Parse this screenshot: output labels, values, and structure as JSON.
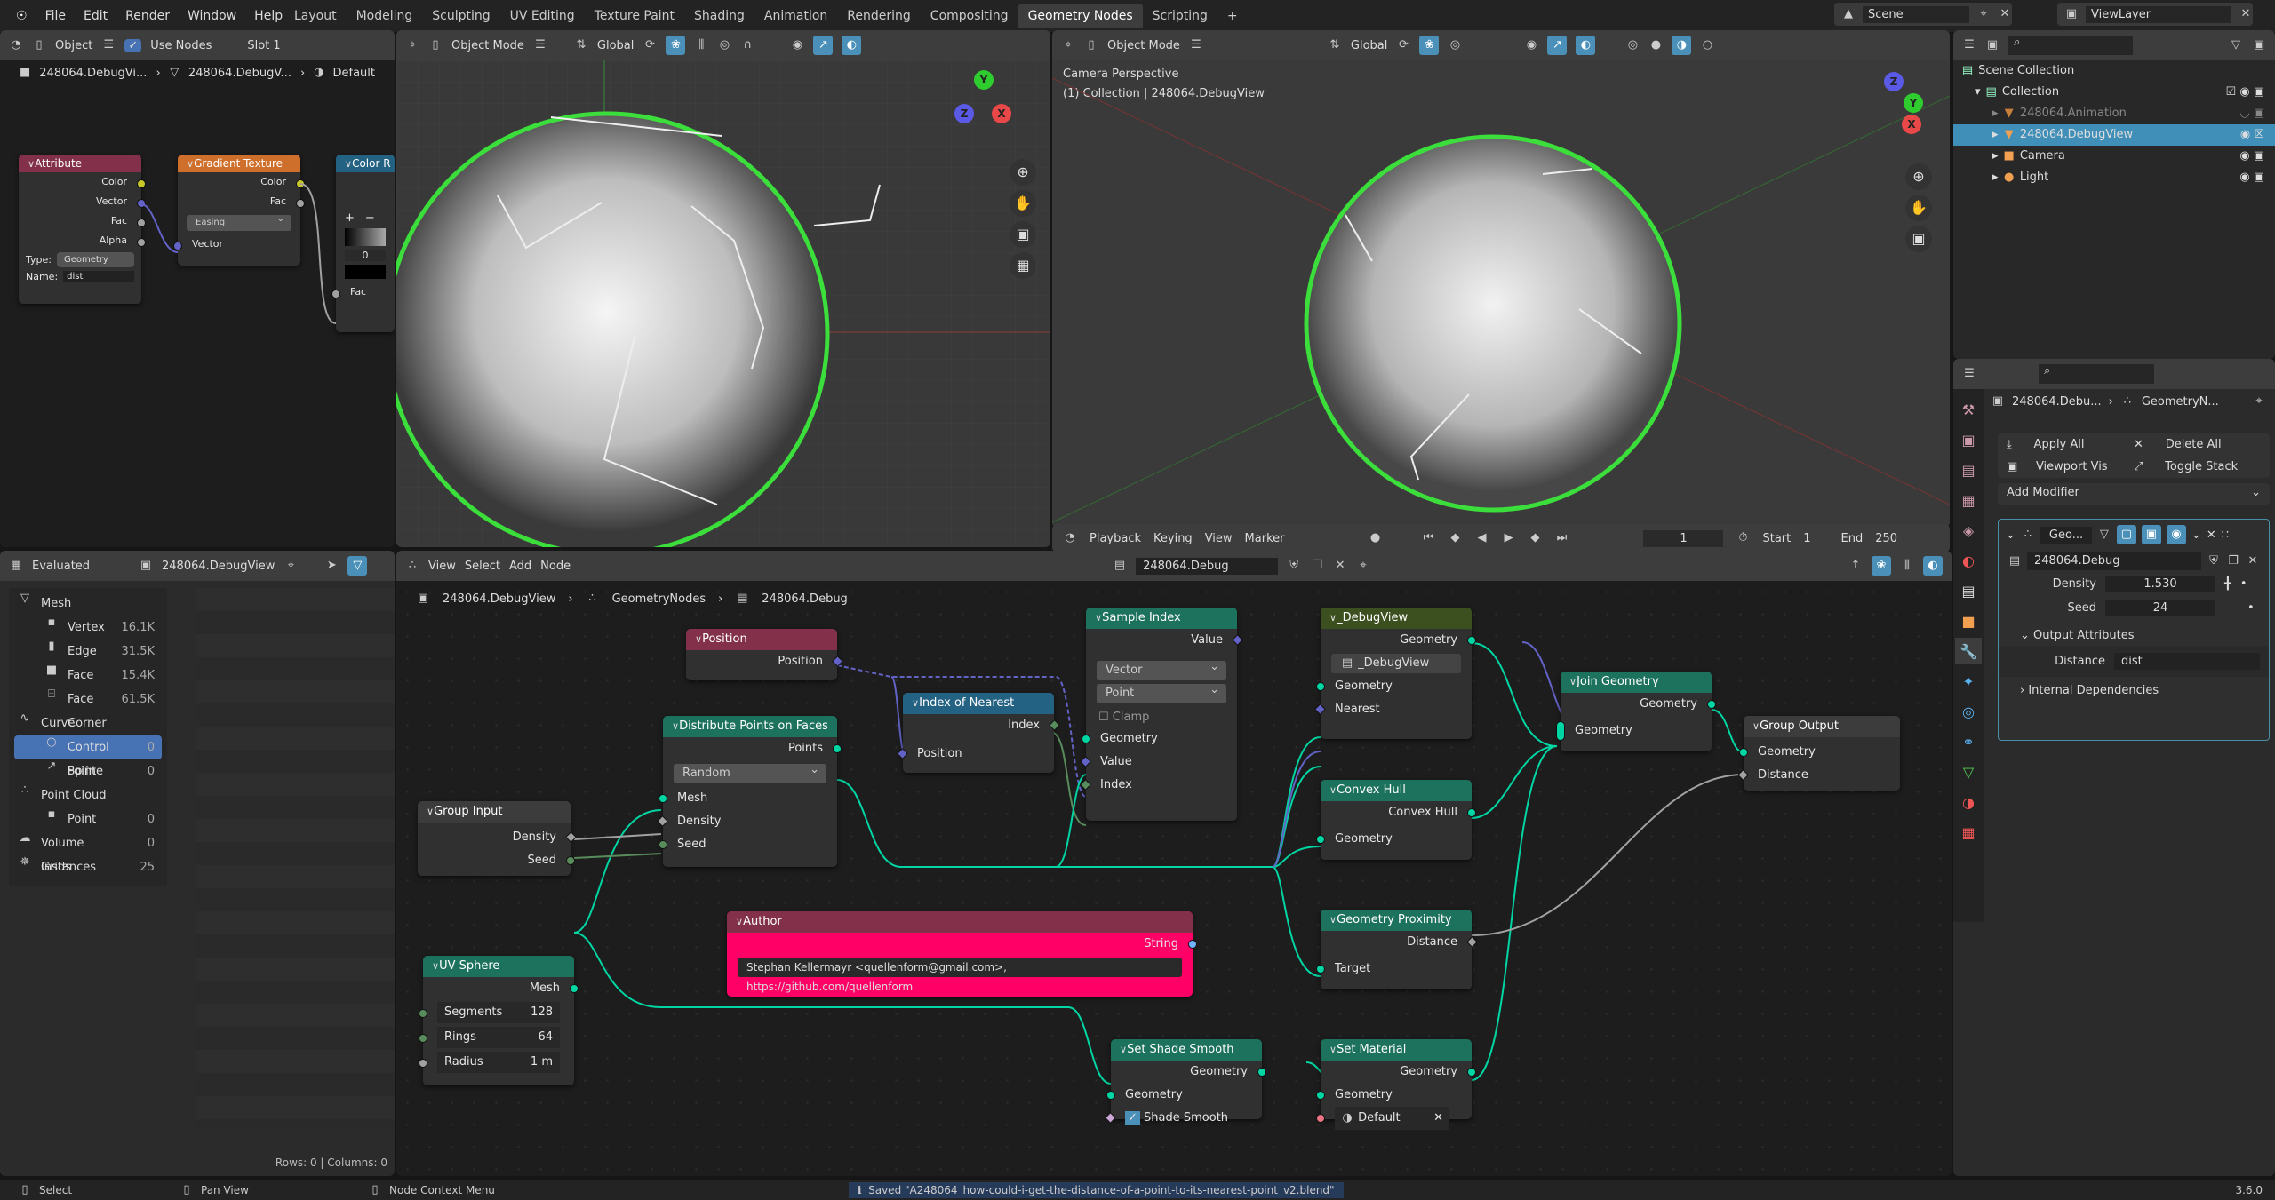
{
  "topbar": {
    "menus": [
      "File",
      "Edit",
      "Render",
      "Window",
      "Help"
    ],
    "workspaces": [
      "Layout",
      "Modeling",
      "Sculpting",
      "UV Editing",
      "Texture Paint",
      "Shading",
      "Animation",
      "Rendering",
      "Compositing",
      "Geometry Nodes",
      "Scripting"
    ],
    "active_workspace": "Geometry Nodes",
    "add_workspace": "+",
    "scene": "Scene",
    "view_layer": "ViewLayer"
  },
  "shader_editor": {
    "object_type": "Object",
    "use_nodes_label": "Use Nodes",
    "use_nodes_checked": true,
    "slot": "Slot 1",
    "breadcrumb": [
      "248064.DebugVi...",
      "248064.DebugV...",
      "Default"
    ],
    "nodes": {
      "attribute": {
        "title": "Attribute",
        "outputs": [
          "Color",
          "Vector",
          "Fac",
          "Alpha"
        ],
        "type_label": "Type:",
        "type_value": "Geometry",
        "name_label": "Name:",
        "name_value": "dist"
      },
      "gradient": {
        "title": "Gradient Texture",
        "outputs": [
          "Color",
          "Fac"
        ],
        "mode": "Easing",
        "input": "Vector"
      },
      "color_ramp": {
        "title": "Color R",
        "plus": "+",
        "minus": "−",
        "pos_value": "0",
        "input": "Fac"
      }
    }
  },
  "viewport_left": {
    "mode": "Object Mode",
    "orientation": "Global",
    "gizmo": {
      "y": "Y",
      "x": "X",
      "z": "Z"
    }
  },
  "viewport_right": {
    "mode": "Object Mode",
    "orientation": "Global",
    "camera_label": "Camera Perspective",
    "collection_label": "(1) Collection | 248064.DebugView",
    "gizmo": {
      "z": "Z",
      "y": "Y",
      "x": "X"
    }
  },
  "outliner": {
    "search_placeholder": "",
    "items": [
      {
        "label": "Scene Collection",
        "level": 0
      },
      {
        "label": "Collection",
        "level": 1
      },
      {
        "label": "248064.Animation",
        "level": 2,
        "dim": true
      },
      {
        "label": "248064.DebugView",
        "level": 2,
        "selected": true
      },
      {
        "label": "Camera",
        "level": 2
      },
      {
        "label": "Light",
        "level": 2
      }
    ]
  },
  "timeline": {
    "menus": [
      "Playback",
      "Keying",
      "View",
      "Marker"
    ],
    "current_frame": "1",
    "start_label": "Start",
    "start": "1",
    "end_label": "End",
    "end": "250"
  },
  "spreadsheet": {
    "mode": "Evaluated",
    "object": "248064.DebugView",
    "rows": [
      {
        "label": "Mesh",
        "count": "",
        "level": 0,
        "icon": "mesh-icon"
      },
      {
        "label": "Vertex",
        "count": "16.1K",
        "level": 1,
        "icon": "vertex-icon"
      },
      {
        "label": "Edge",
        "count": "31.5K",
        "level": 1,
        "icon": "edge-icon"
      },
      {
        "label": "Face",
        "count": "15.4K",
        "level": 1,
        "icon": "face-icon"
      },
      {
        "label": "Face Corner",
        "count": "61.5K",
        "level": 1,
        "icon": "face-corner-icon"
      },
      {
        "label": "Curve",
        "count": "",
        "level": 0,
        "icon": "curve-icon"
      },
      {
        "label": "Control Point",
        "count": "0",
        "level": 1,
        "icon": "control-point-icon",
        "selected": true
      },
      {
        "label": "Spline",
        "count": "0",
        "level": 1,
        "icon": "spline-icon"
      },
      {
        "label": "Point Cloud",
        "count": "",
        "level": 0,
        "icon": "point-cloud-icon"
      },
      {
        "label": "Point",
        "count": "0",
        "level": 1,
        "icon": "point-icon"
      },
      {
        "label": "Volume Grids",
        "count": "0",
        "level": 0,
        "icon": "volume-icon"
      },
      {
        "label": "Instances",
        "count": "25",
        "level": 0,
        "icon": "instances-icon"
      }
    ],
    "footer": "Rows: 0  |  Columns: 0"
  },
  "node_editor": {
    "menus": [
      "View",
      "Select",
      "Add",
      "Node"
    ],
    "node_tree": "248064.Debug",
    "breadcrumb": [
      "248064.DebugView",
      "GeometryNodes",
      "248064.Debug"
    ],
    "nodes": {
      "position": {
        "title": "Position",
        "out": "Position"
      },
      "index_nearest": {
        "title": "Index of Nearest",
        "out": "Index",
        "in": "Position"
      },
      "distribute": {
        "title": "Distribute Points on Faces",
        "out": "Points",
        "mode": "Random",
        "inputs": [
          "Mesh",
          "Density",
          "Seed"
        ]
      },
      "group_input": {
        "title": "Group Input",
        "outputs": [
          "Density",
          "Seed"
        ]
      },
      "sample_index": {
        "title": "Sample Index",
        "out": "Value",
        "type": "Vector",
        "domain": "Point",
        "clamp": "Clamp",
        "inputs": [
          "Geometry",
          "Value",
          "Index"
        ]
      },
      "debugview": {
        "title": "_DebugView",
        "out": "Geometry",
        "group": "_DebugView",
        "inputs": [
          "Geometry",
          "Nearest"
        ]
      },
      "convex_hull": {
        "title": "Convex Hull",
        "out": "Convex Hull",
        "in": "Geometry"
      },
      "proximity": {
        "title": "Geometry Proximity",
        "out": "Distance",
        "in": "Target"
      },
      "join": {
        "title": "Join Geometry",
        "out": "Geometry",
        "in": "Geometry"
      },
      "group_output": {
        "title": "Group Output",
        "inputs": [
          "Geometry",
          "Distance"
        ]
      },
      "author": {
        "title": "Author",
        "out": "String",
        "text": "Stephan Kellermayr <quellenform@gmail.com>, https://github.com/quellenform",
        "color": "#ff0066"
      },
      "uv_sphere": {
        "title": "UV Sphere",
        "out": "Mesh",
        "fields": [
          {
            "label": "Segments",
            "value": "128"
          },
          {
            "label": "Rings",
            "value": "64"
          },
          {
            "label": "Radius",
            "value": "1 m"
          }
        ]
      },
      "shade_smooth": {
        "title": "Set Shade Smooth",
        "out": "Geometry",
        "in": "Geometry",
        "check_label": "Shade Smooth",
        "checked": true
      },
      "set_material": {
        "title": "Set Material",
        "out": "Geometry",
        "in": "Geometry",
        "material": "Default"
      }
    }
  },
  "properties": {
    "breadcrumb": [
      "248064.Debu...",
      "GeometryN..."
    ],
    "apply_all": "Apply All",
    "delete_all": "Delete All",
    "viewport_vis": "Viewport Vis",
    "toggle_stack": "Toggle Stack",
    "add_modifier": "Add Modifier",
    "modifier_name": "Geo...",
    "node_group": "248064.Debug",
    "density_label": "Density",
    "density": "1.530",
    "seed_label": "Seed",
    "seed": "24",
    "output_attributes": "Output Attributes",
    "distance_label": "Distance",
    "distance_value": "dist",
    "internal_deps": "Internal Dependencies"
  },
  "status": {
    "select": "Select",
    "pan": "Pan View",
    "context": "Node Context Menu",
    "message": "Saved \"A248064_how-could-i-get-the-distance-of-a-point-to-its-nearest-point_v2.blend\"",
    "version": "3.6.0"
  }
}
